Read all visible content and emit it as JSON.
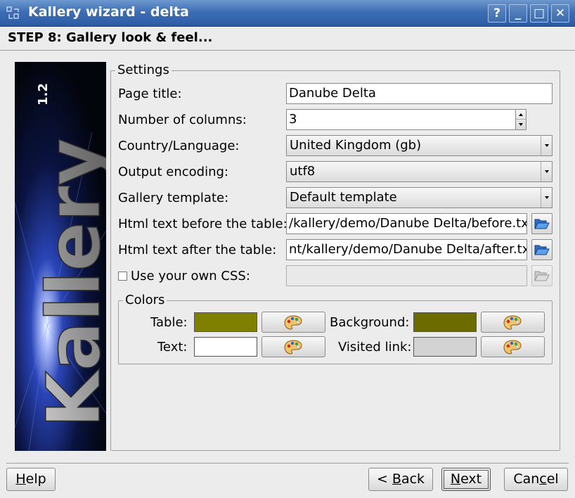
{
  "window": {
    "title": "Kallery wizard - delta",
    "buttons": {
      "help": "?",
      "minimize": "_",
      "maximize": "□",
      "close": "✕"
    }
  },
  "step": {
    "title": "STEP 8: Gallery look & feel..."
  },
  "banner": {
    "brand": "Kallery",
    "version": "1.2"
  },
  "settings": {
    "group_label": "Settings",
    "page_title": {
      "label": "Page title:",
      "value": "Danube Delta"
    },
    "columns": {
      "label": "Number of columns:",
      "value": "3"
    },
    "country": {
      "label": "Country/Language:",
      "value": "United Kingdom (gb)"
    },
    "encoding": {
      "label": "Output encoding:",
      "value": "utf8"
    },
    "template": {
      "label": "Gallery template:",
      "value": "Default template"
    },
    "html_before": {
      "label": "Html text before the table:",
      "value": "/kallery/demo/Danube Delta/before.txt"
    },
    "html_after": {
      "label": "Html text after the table:",
      "value": "nt/kallery/demo/Danube Delta/after.txt"
    },
    "css": {
      "label": "Use your own CSS:",
      "value": "",
      "checked": false
    }
  },
  "colors": {
    "group_label": "Colors",
    "table": {
      "label": "Table:",
      "color": "#808000"
    },
    "background": {
      "label": "Background:",
      "color": "#6b6b00"
    },
    "text": {
      "label": "Text:",
      "color": "#ffffff"
    },
    "visited": {
      "label": "Visited link:",
      "color": "#d3d3d3"
    }
  },
  "footer": {
    "help": {
      "pre": "",
      "key": "H",
      "post": "elp"
    },
    "back": {
      "pre": "< ",
      "key": "B",
      "post": "ack"
    },
    "next": {
      "pre": "",
      "key": "N",
      "post": "ext"
    },
    "cancel": {
      "pre": "Can",
      "key": "c",
      "post": "el"
    }
  },
  "icons": {
    "app": "wizard-icon",
    "browse": "folder-open-icon",
    "palette": "palette-icon"
  }
}
